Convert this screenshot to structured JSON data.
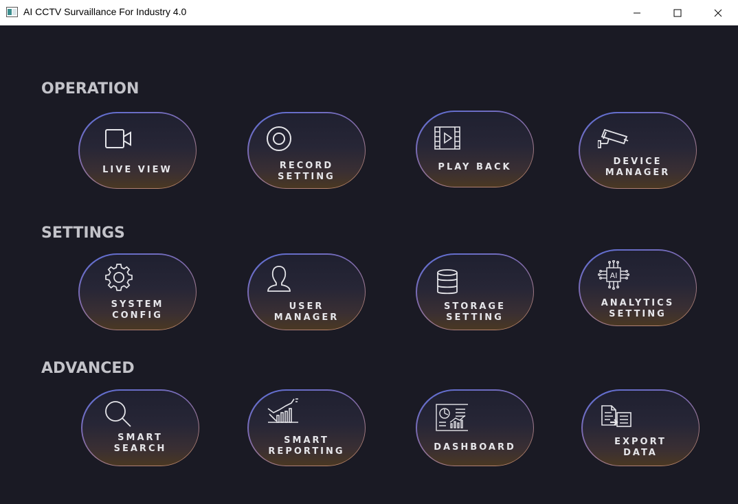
{
  "window": {
    "title": "AI CCTV Survaillance For Industry 4.0",
    "controls": [
      "minimize",
      "maximize",
      "close"
    ]
  },
  "sections": {
    "operation": "OPERATION",
    "settings": "SETTINGS",
    "advanced": "ADVANCED"
  },
  "tiles": {
    "live_view": {
      "label": "LIVE VIEW",
      "icon": "video-camera-icon"
    },
    "record_setting": {
      "label": "RECORD\nSETTING",
      "icon": "record-icon"
    },
    "play_back": {
      "label": "PLAY BACK",
      "icon": "film-play-icon"
    },
    "device_manager": {
      "label": "DEVICE\nMANAGER",
      "icon": "cctv-camera-icon"
    },
    "system_config": {
      "label": "SYSTEM\nCONFIG",
      "icon": "gear-icon"
    },
    "user_manager": {
      "label": "USER\nMANAGER",
      "icon": "user-icon"
    },
    "storage_setting": {
      "label": "STORAGE\nSETTING",
      "icon": "database-icon"
    },
    "analytics_setting": {
      "label": "ANALYTICS\nSETTING",
      "icon": "ai-chip-icon"
    },
    "smart_search": {
      "label": "SMART\nSEARCH",
      "icon": "search-icon"
    },
    "smart_reporting": {
      "label": "SMART\nREPORTING",
      "icon": "bar-chart-icon"
    },
    "dashboard": {
      "label": "DASHBOARD",
      "icon": "dashboard-icon"
    },
    "export_data": {
      "label": "EXPORT\nDATA",
      "icon": "export-document-icon"
    }
  }
}
